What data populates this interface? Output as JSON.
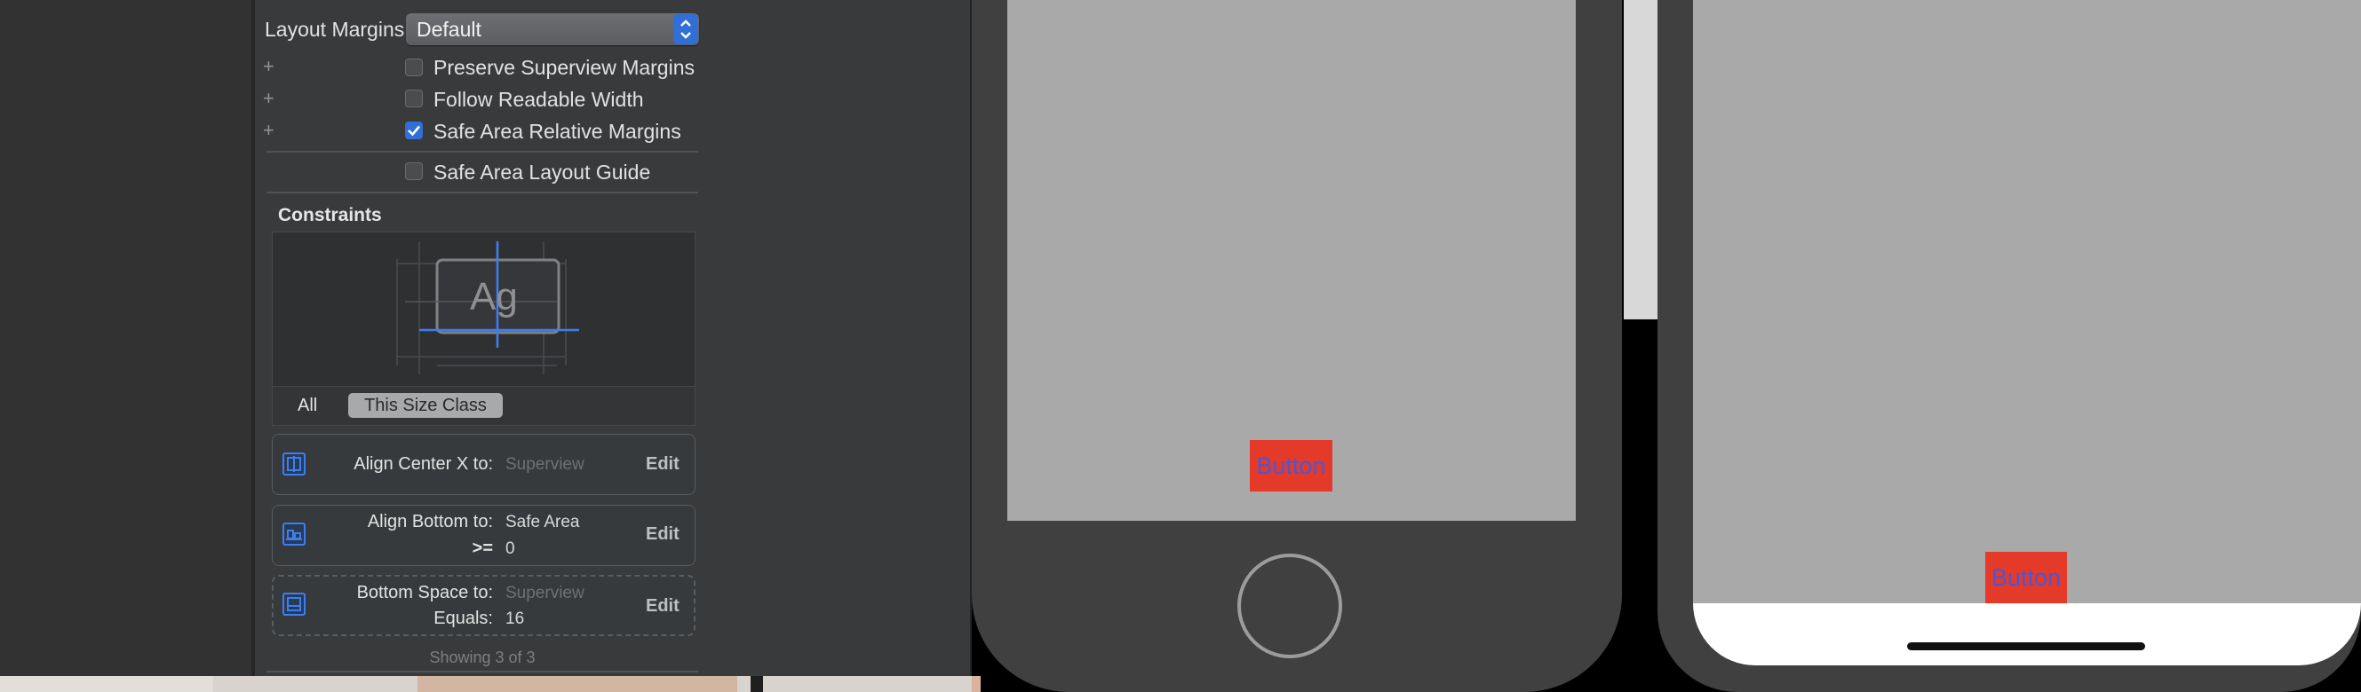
{
  "inspector": {
    "layout_margins_label": "Layout Margins",
    "layout_margins_value": "Default",
    "plus_symbol": "+",
    "checkboxes": [
      {
        "label": "Preserve Superview Margins",
        "checked": false
      },
      {
        "label": "Follow Readable Width",
        "checked": false
      },
      {
        "label": "Safe Area Relative Margins",
        "checked": true
      },
      {
        "label": "Safe Area Layout Guide",
        "checked": false
      }
    ],
    "constraints_title": "Constraints",
    "diagram_text": "Ag",
    "tabs": {
      "all": "All",
      "size_class": "This Size Class"
    },
    "constraint_rows": [
      {
        "label1": "Align Center X to:",
        "value1": "Superview",
        "label2": "",
        "value2": "",
        "edit": "Edit",
        "icon": "align-center-x-icon",
        "dashed": false
      },
      {
        "label1": "Align Bottom to:",
        "value1": "Safe Area",
        "label2": ">=",
        "value2": "0",
        "edit": "Edit",
        "icon": "align-bottom-icon",
        "dashed": false
      },
      {
        "label1": "Bottom Space to:",
        "value1": "Superview",
        "label2": "Equals:",
        "value2": "16",
        "edit": "Edit",
        "icon": "bottom-space-icon",
        "dashed": true
      }
    ],
    "showing_count": "Showing 3 of 3"
  },
  "canvas": {
    "device1_button": "Button",
    "device2_button": "Button"
  },
  "colors": {
    "accent_blue": "#2f6fd6",
    "button_red": "#e43a2a",
    "button_text_blue": "#4a57d6",
    "device_frame": "#404040",
    "screen_gray": "#a9a9a9"
  }
}
